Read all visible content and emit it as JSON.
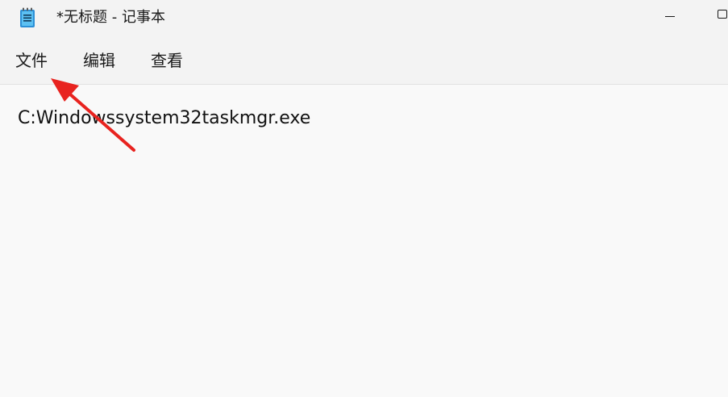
{
  "window": {
    "title": "*无标题 - 记事本",
    "icon": "notepad-icon"
  },
  "controls": {
    "minimize_icon": "minimize-icon",
    "maximize_icon": "maximize-icon"
  },
  "menu": {
    "items": [
      {
        "label": "文件"
      },
      {
        "label": "编辑"
      },
      {
        "label": "查看"
      }
    ]
  },
  "editor": {
    "content": "C:Windowssystem32taskmgr.exe"
  },
  "annotation": {
    "icon": "red-arrow-icon",
    "color": "#e8231f"
  }
}
